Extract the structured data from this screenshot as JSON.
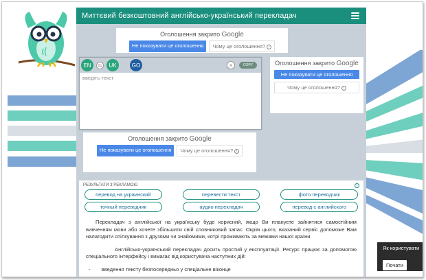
{
  "header": {
    "title": "Миттєвий безкоштовний англійсько-український перекладач"
  },
  "ads": {
    "closed_prefix": "Оголошення закрито",
    "google_label": "Google",
    "stop_button": "Не показувати це оголошення",
    "why_link": "Чому це оголошення?",
    "side_why_link": "Чому це оголошення?"
  },
  "translator": {
    "source_lang": "EN",
    "swap_symbol": "⇆",
    "target_lang": "UK",
    "go_button": "GO",
    "clear_symbol": "×",
    "copy_button": "COPY",
    "placeholder": "введіть текст"
  },
  "results": {
    "heading": "РЕЗУЛЬТАТИ З РЕКЛАМОЮ",
    "info_symbol": "i",
    "links": [
      "перевод на украинский",
      "перевести текст",
      "фото переводчик",
      "точный переводчик",
      "аудио переклaдач",
      "перевод с английского"
    ],
    "paragraph1": "Перекладач з англійської на українську буде корисний, якщо Ви плануєте зайнятися самостійним вивченням мови або хочете збільшити свій словниковий запас. Окрім цього, вказаний сервіс допоможе Вам налагодити спілкування з друзями чи знайомими, котрі проживають за межами нашої країни.",
    "paragraph2": "Англійсько-український перекладач досить простий у експлуатації. Ресурс працює за допомогою спеціального інтерфейсу і вимагає від користувача наступних дій:",
    "bullet_marker": "-",
    "bullet1": "введення тексту безпосередньо у спеціальне віконце"
  },
  "cookie": {
    "text": "Як користувати",
    "button": "Почати"
  },
  "colors": {
    "header_teal": "#1a8f7d",
    "ad_blue": "#4a88e8",
    "lang_green": "#2aa57c",
    "lang_blue": "#1f5fa0",
    "stripe_blue": "#7ea6d4",
    "stripe_teal": "#6fcfbe"
  }
}
